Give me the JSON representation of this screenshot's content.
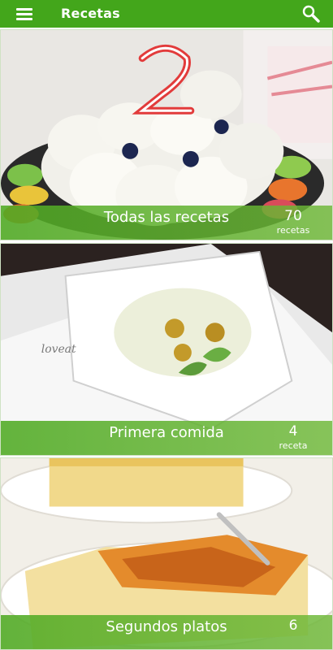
{
  "app": {
    "title": "Recetas",
    "menu_icon": "menu-icon",
    "search_icon": "search-icon",
    "accent_color": "#43a61b"
  },
  "categories": [
    {
      "name": "Todas las recetas",
      "count": "70",
      "unit": "recetas"
    },
    {
      "name": "Primera comida",
      "count": "4",
      "unit": "receta"
    },
    {
      "name": "Segundos platos",
      "count": "6",
      "unit": ""
    }
  ]
}
